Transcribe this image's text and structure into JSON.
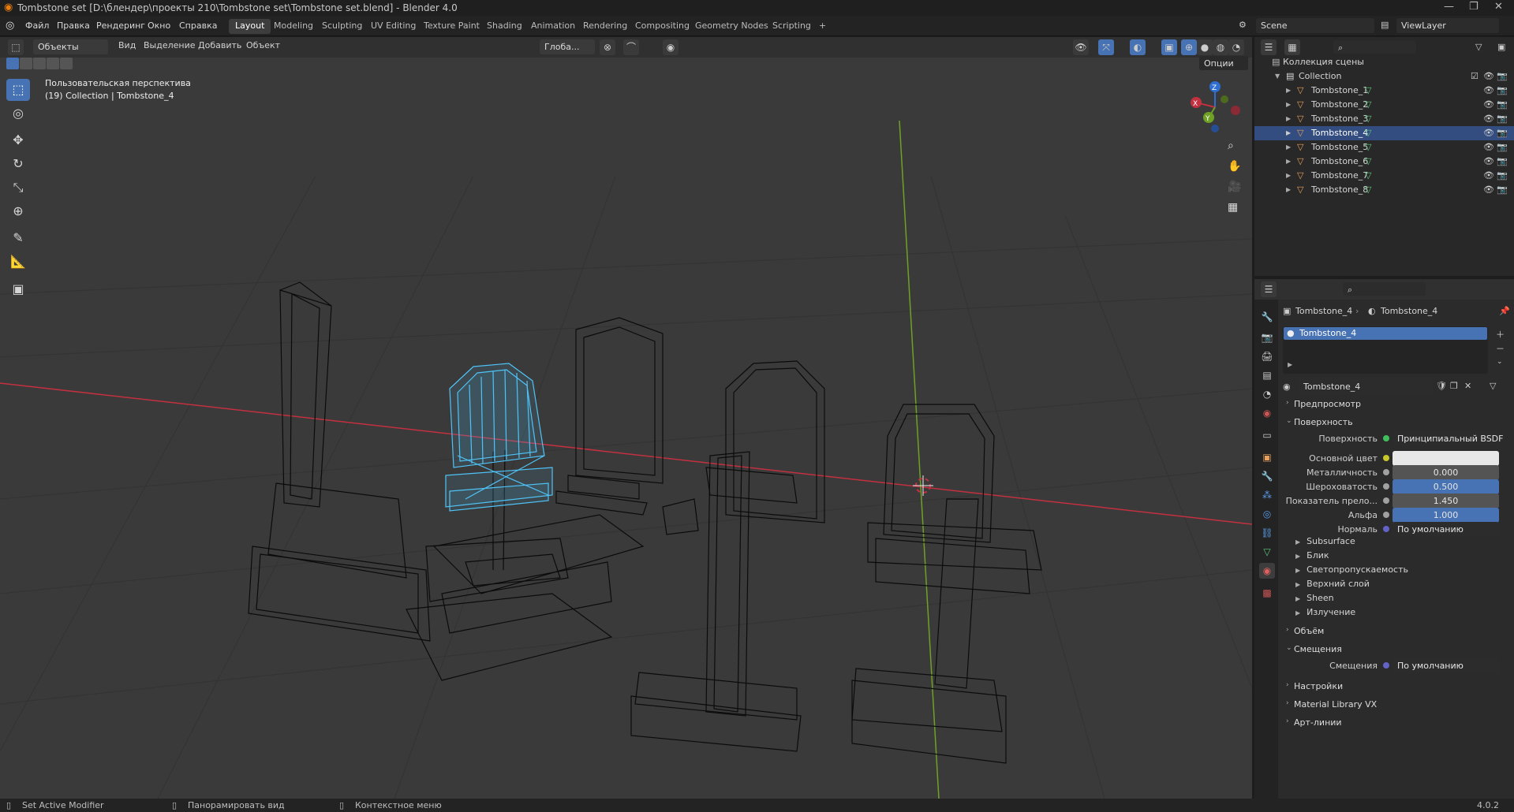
{
  "window": {
    "title": "Tombstone set [D:\\блендер\\проекты 210\\Tombstone set\\Tombstone set.blend] - Blender 4.0"
  },
  "menu": {
    "items": [
      "Файл",
      "Правка",
      "Рендеринг",
      "Окно",
      "Справка"
    ]
  },
  "workspaces": [
    "Layout",
    "Modeling",
    "Sculpting",
    "UV Editing",
    "Texture Paint",
    "Shading",
    "Animation",
    "Rendering",
    "Compositing",
    "Geometry Nodes",
    "Scripting"
  ],
  "workspace_add": "+",
  "scene": {
    "label": "Scene",
    "viewlayer": "ViewLayer"
  },
  "viewport_header": {
    "mode": "Объекты",
    "view": "Вид",
    "select": "Выделение",
    "add": "Добавить",
    "object": "Объект",
    "orientation": "Глоба...",
    "options": "Опции"
  },
  "viewport": {
    "perspective": "Пользовательская перспектива",
    "collection_info": "(19) Collection | Tombstone_4"
  },
  "gizmo": {
    "x": "X",
    "y": "Y",
    "z": "Z"
  },
  "outliner": {
    "root": "Коллекция сцены",
    "collection": "Collection",
    "items": [
      "Tombstone_1",
      "Tombstone_2",
      "Tombstone_3",
      "Tombstone_4",
      "Tombstone_5",
      "Tombstone_6",
      "Tombstone_7",
      "Tombstone_8"
    ],
    "selected_index": 3
  },
  "properties": {
    "breadcrumb_object": "Tombstone_4",
    "breadcrumb_material": "Tombstone_4",
    "slot": "Tombstone_4",
    "material_name": "Tombstone_4",
    "panels": {
      "preview": "Предпросмотр",
      "surface": "Поверхность",
      "volume": "Объём",
      "displacement": "Смещения",
      "settings": "Настройки",
      "matlib": "Material Library VX",
      "lineart": "Арт-линии"
    },
    "surface": {
      "surface_label": "Поверхность",
      "surface_value": "Принципиальный BSDF",
      "base_color_label": "Основной цвет",
      "base_color": "#e8e8e8",
      "metallic_label": "Металличность",
      "metallic": "0.000",
      "roughness_label": "Шероховатость",
      "roughness": "0.500",
      "ior_label": "Показатель прело...",
      "ior": "1.450",
      "alpha_label": "Альфа",
      "alpha": "1.000",
      "normal_label": "Нормаль",
      "normal": "По умолчанию"
    },
    "subpanels": [
      "Subsurface",
      "Блик",
      "Светопропускаемость",
      "Верхний слой",
      "Sheen",
      "Излучение"
    ],
    "displacement": {
      "label": "Смещения",
      "value": "По умолчанию"
    }
  },
  "status": {
    "left": "Set Active Modifier",
    "middle": "Панорамировать вид",
    "right": "Контекстное меню",
    "version": "4.0.2"
  },
  "colors": {
    "accent": "#4772b3",
    "selection": "#4fc3f7",
    "x_axis": "#c3303f",
    "y_axis": "#6fa125",
    "z_axis": "#2f6fd1"
  }
}
